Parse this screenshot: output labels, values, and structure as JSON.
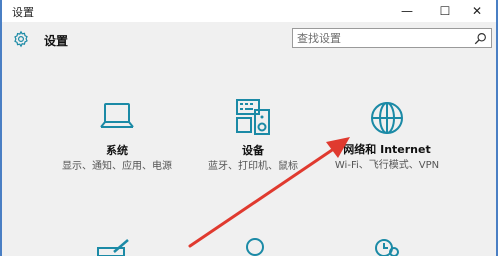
{
  "window": {
    "title": "设置"
  },
  "controls": {
    "minimize": "—",
    "maximize": "☐",
    "close": "✕"
  },
  "header": {
    "title": "设置"
  },
  "search": {
    "placeholder": "查找设置"
  },
  "tiles": [
    {
      "label": "系统",
      "desc": "显示、通知、应用、电源"
    },
    {
      "label": "设备",
      "desc": "蓝牙、打印机、鼠标"
    },
    {
      "label": "网络和 Internet",
      "desc": "Wi-Fi、飞行模式、VPN"
    }
  ],
  "colors": {
    "accent": "#1b8aa6",
    "annotation_arrow": "#e03a2f"
  }
}
